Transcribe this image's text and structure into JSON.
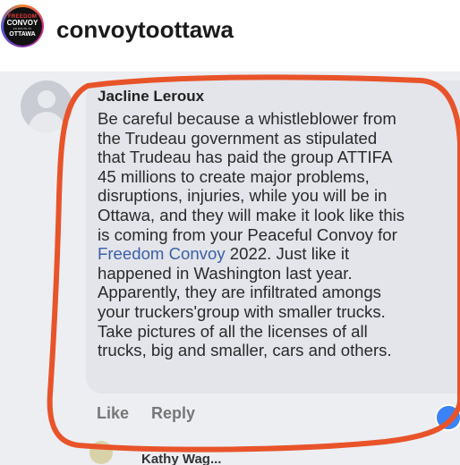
{
  "header": {
    "avatar_lines": [
      "FREEDOM",
      "CONVOY",
      "EN ROUTE TO",
      "OTTAWA"
    ],
    "username": "convoytoottawa"
  },
  "comment": {
    "author": "Jacline Leroux",
    "lines": [
      "Be careful because a whistleblower from",
      "the Trudeau government  as stipulated",
      "that Trudeau has paid the group ATTIFA",
      "45 millions to create major problems,",
      "disruptions, injuries, while you will be in",
      "Ottawa, and they will make it look like this",
      "is coming from your Peaceful Convoy for"
    ],
    "link_text": "Freedom Convoy",
    "line_after_link": " 2022. Just like it",
    "lines_tail": [
      "happened in Washington last year.",
      "Apparently, they are infiltrated amongs",
      "your truckers'group with smaller trucks.",
      "Take pictures of all the licenses of all",
      "trucks, big and smaller, cars and others."
    ],
    "actions": {
      "like": "Like",
      "reply": "Reply"
    }
  },
  "next_comment": {
    "author": "Kathy Wag..."
  },
  "colors": {
    "annotation": "#e8532a",
    "link": "#3a5fa8"
  },
  "icons": [
    "default-avatar-icon",
    "reaction-icon"
  ]
}
